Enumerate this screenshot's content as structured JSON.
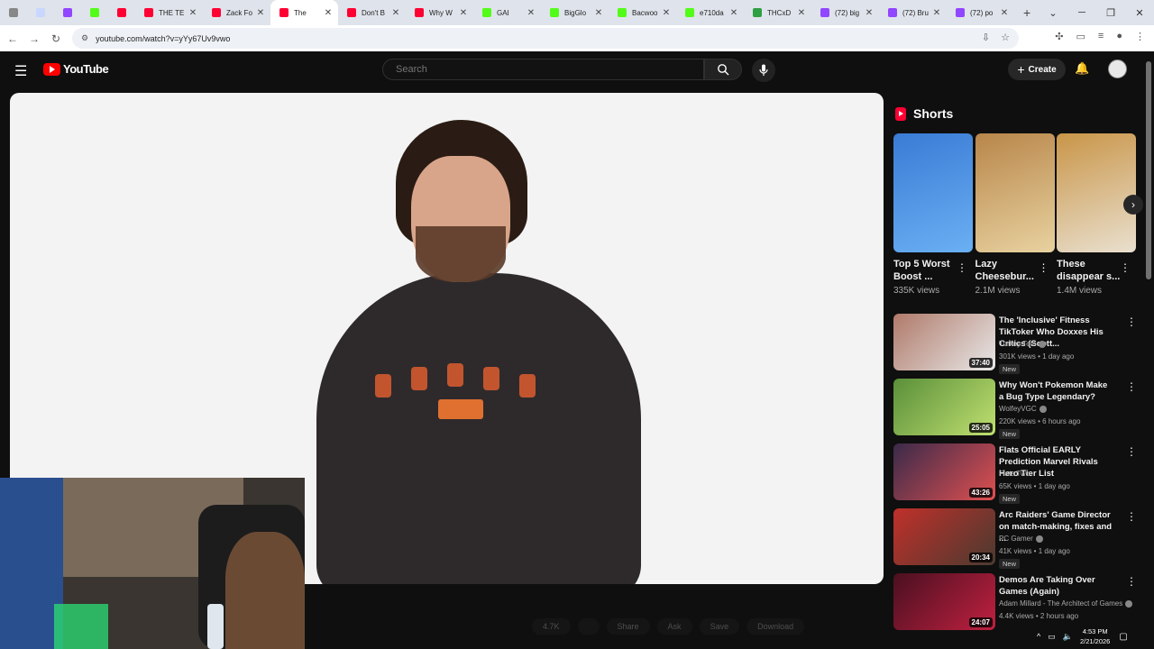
{
  "browser": {
    "tabs": [
      {
        "label": "",
        "fav": "#888888",
        "pinned": true
      },
      {
        "label": "",
        "fav": "#c9d6ff",
        "pinned": true
      },
      {
        "label": "",
        "fav": "#9146ff",
        "pinned": true
      },
      {
        "label": "",
        "fav": "#53fc18",
        "pinned": true
      },
      {
        "label": "",
        "fav": "#ff0033",
        "pinned": true
      },
      {
        "label": "THE TE",
        "fav": "#ff0033"
      },
      {
        "label": "Zack Fo",
        "fav": "#ff0033"
      },
      {
        "label": "The",
        "fav": "#ff0033",
        "active": true
      },
      {
        "label": "Don't B",
        "fav": "#ff0033"
      },
      {
        "label": "Why W",
        "fav": "#ff0033"
      },
      {
        "label": "GAI",
        "fav": "#53fc18"
      },
      {
        "label": "BigGlo",
        "fav": "#53fc18"
      },
      {
        "label": "Bacwoo",
        "fav": "#53fc18"
      },
      {
        "label": "e710da",
        "fav": "#53fc18"
      },
      {
        "label": "THCxD",
        "fav": "#2ea043"
      },
      {
        "label": "(72) big",
        "fav": "#9146ff"
      },
      {
        "label": "(72) Bru",
        "fav": "#9146ff"
      },
      {
        "label": "(72) po",
        "fav": "#9146ff"
      }
    ],
    "url": "youtube.com/watch?v=yYy67Uv9vwo"
  },
  "header": {
    "logo_text": "YouTube",
    "search_placeholder": "Search",
    "create_label": "Create"
  },
  "shorts": {
    "title": "Shorts",
    "items": [
      {
        "title": "Top 5 Worst Boost ...",
        "views": "335K views",
        "c1": "#3a7bd5",
        "c2": "#6ab0f3"
      },
      {
        "title": "Lazy Cheesebur...",
        "views": "2.1M views",
        "c1": "#b8864a",
        "c2": "#e8d2a0"
      },
      {
        "title": "These disappear s...",
        "views": "1.4M views",
        "c1": "#c99548",
        "c2": "#e9e0cf"
      }
    ]
  },
  "recommended": [
    {
      "title": "The 'Inclusive' Fitness TikToker Who Doxxes His Critics (Scott...",
      "channel": "Turkey Tom",
      "verified": true,
      "meta": "301K views • 1 day ago",
      "badge": "New",
      "duration": "37:40",
      "c1": "#b07a6a",
      "c2": "#e8e8e8"
    },
    {
      "title": "Why Won't Pokemon Make a Bug Type Legendary?",
      "channel": "WolfeyVGC",
      "verified": true,
      "meta": "220K views • 6 hours ago",
      "badge": "New",
      "duration": "25:05",
      "c1": "#5a8f3a",
      "c2": "#c0e070"
    },
    {
      "title": "Flats Official EARLY Prediction Marvel Rivals Hero Tier List",
      "channel": "Flats Two",
      "verified": false,
      "meta": "65K views • 1 day ago",
      "badge": "New",
      "duration": "43:26",
      "c1": "#3a2a4a",
      "c2": "#e05050"
    },
    {
      "title": "Arc Raiders' Game Director on match-making, fixes and ...",
      "channel": "PC Gamer",
      "verified": true,
      "meta": "41K views • 1 day ago",
      "badge": "New",
      "duration": "20:34",
      "c1": "#c0302a",
      "c2": "#4a3a30"
    },
    {
      "title": "Demos Are Taking Over Games (Again)",
      "channel": "Adam Millard - The Architect of Games",
      "verified": true,
      "meta": "4.4K views • 2 hours ago",
      "badge": "",
      "duration": "24:07",
      "c1": "#4a1020",
      "c2": "#c02040"
    }
  ],
  "actions": [
    "4.7K",
    "",
    "Share",
    "Ask",
    "Save",
    "Download"
  ],
  "system": {
    "time": "4:53 PM",
    "date": "2/21/2026"
  }
}
